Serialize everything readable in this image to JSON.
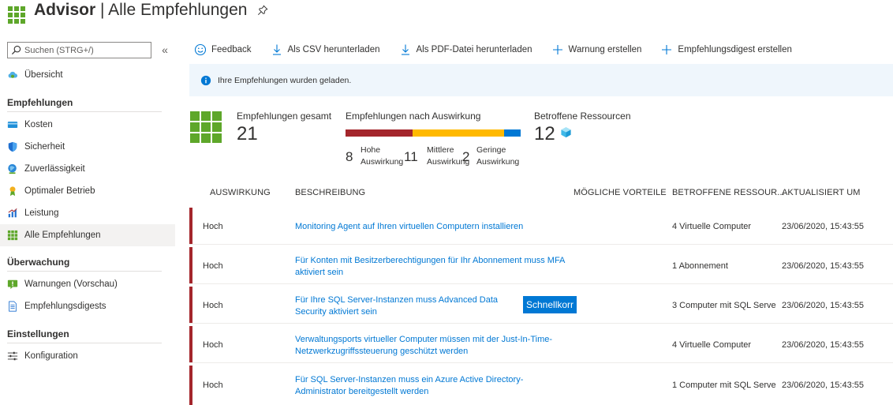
{
  "header": {
    "brand": "Advisor",
    "title": "| Alle Empfehlungen"
  },
  "sidebar": {
    "search_placeholder": "Suchen (STRG+/)",
    "collapse_label": "«",
    "overview": "Übersicht",
    "sections": {
      "recommendations": "Empfehlungen",
      "monitoring": "Überwachung",
      "settings": "Einstellungen"
    },
    "items": {
      "costs": "Kosten",
      "security": "Sicherheit",
      "reliability": "Zuverlässigkeit",
      "operations": "Optimaler Betrieb",
      "performance": "Leistung",
      "all": "Alle Empfehlungen",
      "alerts": "Warnungen (Vorschau)",
      "digests": "Empfehlungsdigests",
      "configuration": "Konfiguration"
    }
  },
  "toolbar": {
    "feedback": "Feedback",
    "csv": "Als CSV herunterladen",
    "pdf": "Als PDF-Datei herunterladen",
    "alert": "Warnung erstellen",
    "digest": "Empfehlungsdigest erstellen"
  },
  "banner": {
    "text": "Ihre Empfehlungen wurden geladen."
  },
  "summary": {
    "total_label": "Empfehlungen gesamt",
    "total_value": "21",
    "impact_label": "Empfehlungen nach Auswirkung",
    "impact": [
      {
        "count": 8,
        "label1": "Hohe",
        "label2": "Auswirkung",
        "color": "#a4262c"
      },
      {
        "count": 11,
        "label1": "Mittlere",
        "label2": "Auswirkung",
        "color": "#ffb900"
      },
      {
        "count": 2,
        "label1": "Geringe",
        "label2": "Auswirkung",
        "color": "#0078d4"
      }
    ],
    "resources_label": "Betroffene Ressourcen",
    "resources_value": "12"
  },
  "table": {
    "headers": {
      "impact": "AUSWIRKUNG",
      "description": "BESCHREIBUNG",
      "benefits": "MÖGLICHE VORTEILE",
      "resources": "BETROFFENE RESSOUR...",
      "updated": "AKTUALISIERT UM"
    },
    "rows": [
      {
        "impact": "Hoch",
        "description": "Monitoring Agent auf Ihren virtuellen Computern installieren",
        "resources": "4 Virtuelle Computer",
        "updated": "23/06/2020, 15:43:55"
      },
      {
        "impact": "Hoch",
        "description": "Für Konten mit Besitzerberechtigungen für Ihr Abonnement muss MFA aktiviert sein",
        "resources": "1 Abonnement",
        "updated": "23/06/2020, 15:43:55"
      },
      {
        "impact": "Hoch",
        "description": "Für Ihre SQL Server-Instanzen muss Advanced Data Security aktiviert sein",
        "quickfix": "Schnellkorr",
        "resources": "3 Computer mit SQL Serve",
        "updated": "23/06/2020, 15:43:55"
      },
      {
        "impact": "Hoch",
        "description": "Verwaltungsports virtueller Computer müssen mit der Just-In-Time-Netzwerkzugriffssteuerung geschützt werden",
        "resources": "4 Virtuelle Computer",
        "updated": "23/06/2020, 15:43:55"
      },
      {
        "impact": "Hoch",
        "description": "Für SQL Server-Instanzen muss ein Azure Active Directory-Administrator bereitgestellt werden",
        "resources": "1 Computer mit SQL Serve",
        "updated": "23/06/2020, 15:43:55"
      }
    ]
  },
  "colors": {
    "accent": "#0078d4",
    "high": "#a4262c",
    "medium": "#ffb900",
    "low": "#0078d4",
    "advisor_green": "#5ea72a"
  }
}
